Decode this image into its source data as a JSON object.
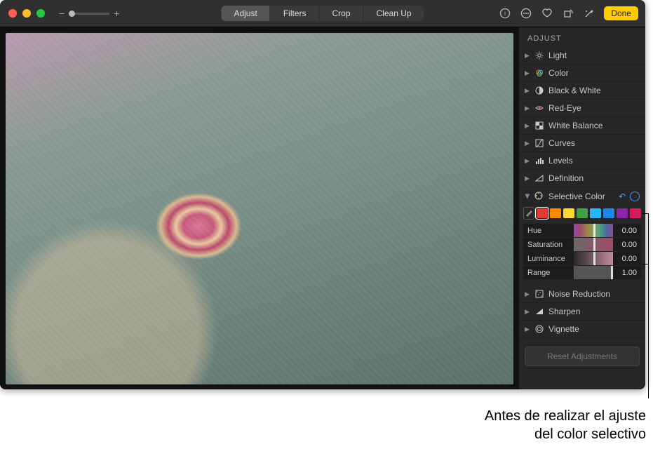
{
  "toolbar": {
    "tabs": [
      "Adjust",
      "Filters",
      "Crop",
      "Clean Up"
    ],
    "active_tab": 0,
    "done_label": "Done"
  },
  "sidebar": {
    "title": "ADJUST",
    "items": [
      {
        "label": "Light",
        "icon": "sun"
      },
      {
        "label": "Color",
        "icon": "rings"
      },
      {
        "label": "Black & White",
        "icon": "halfcircle"
      },
      {
        "label": "Red-Eye",
        "icon": "eye"
      },
      {
        "label": "White Balance",
        "icon": "checker"
      },
      {
        "label": "Curves",
        "icon": "curve"
      },
      {
        "label": "Levels",
        "icon": "bars"
      },
      {
        "label": "Definition",
        "icon": "triangle"
      }
    ],
    "selective": {
      "label": "Selective Color",
      "swatches": [
        "#e53935",
        "#fb8c00",
        "#fdd835",
        "#43a047",
        "#29b6f6",
        "#1e88e5",
        "#8e24aa",
        "#d81b60"
      ],
      "selected_swatch": 0,
      "sliders": {
        "hue": {
          "label": "Hue",
          "value": "0.00",
          "pos": 50
        },
        "saturation": {
          "label": "Saturation",
          "value": "0.00",
          "pos": 50
        },
        "luminance": {
          "label": "Luminance",
          "value": "0.00",
          "pos": 50
        },
        "range": {
          "label": "Range",
          "value": "1.00",
          "pos": 100
        }
      }
    },
    "items_after": [
      {
        "label": "Noise Reduction",
        "icon": "noise"
      },
      {
        "label": "Sharpen",
        "icon": "sharp"
      },
      {
        "label": "Vignette",
        "icon": "circle"
      }
    ],
    "reset_label": "Reset Adjustments"
  },
  "caption": {
    "line1": "Antes de realizar el ajuste",
    "line2": "del color selectivo"
  }
}
